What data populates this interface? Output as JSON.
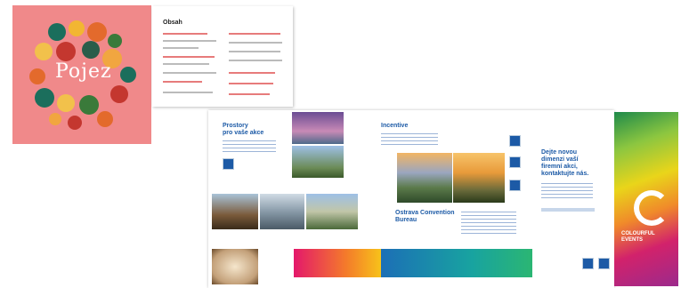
{
  "cover": {
    "title": "Pojez"
  },
  "toc": {
    "heading": "Obsah"
  },
  "left_panel": {
    "heading_line1": "Prostory",
    "heading_line2": "pro vaše akce"
  },
  "mid_panel": {
    "heading": "Incentive",
    "bureau_title": "Ostrava Convention",
    "bureau_title2": "Bureau"
  },
  "right_panel": {
    "heading_line1": "Dejte novou",
    "heading_line2": "dimenzi vaší",
    "heading_line3": "firemní akci,",
    "heading_line4": "kontaktujte nás."
  },
  "back_cover": {
    "title_line1": "COLOURFUL",
    "title_line2": "EVENTS"
  },
  "colors": {
    "accent": "#1c5aa6",
    "cover_pink": "#f0898a"
  }
}
